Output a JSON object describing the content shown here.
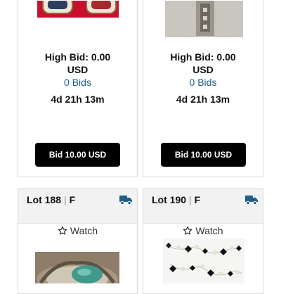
{
  "cards": [
    {
      "high_bid": "High Bid: 0.00",
      "currency": "USD",
      "bids": "0 Bids",
      "time_left": "4d 21h 13m",
      "bid_button": "Bid 10.00 USD"
    },
    {
      "high_bid": "High Bid: 0.00",
      "currency": "USD",
      "bids": "0 Bids",
      "time_left": "4d 21h 13m",
      "bid_button": "Bid 10.00 USD"
    }
  ],
  "lots": [
    {
      "lot": "Lot 188",
      "separator": "|",
      "grade": "F",
      "watch": "Watch",
      "shipping_icon": "truck-icon"
    },
    {
      "lot": "Lot 190",
      "separator": "|",
      "grade": "F",
      "watch": "Watch",
      "shipping_icon": "truck-icon"
    }
  ],
  "colors": {
    "link": "#1f5f8b",
    "shipping_icon": "#1f5f8b",
    "button_bg": "#000000",
    "header_bg": "#f2f2f2"
  }
}
